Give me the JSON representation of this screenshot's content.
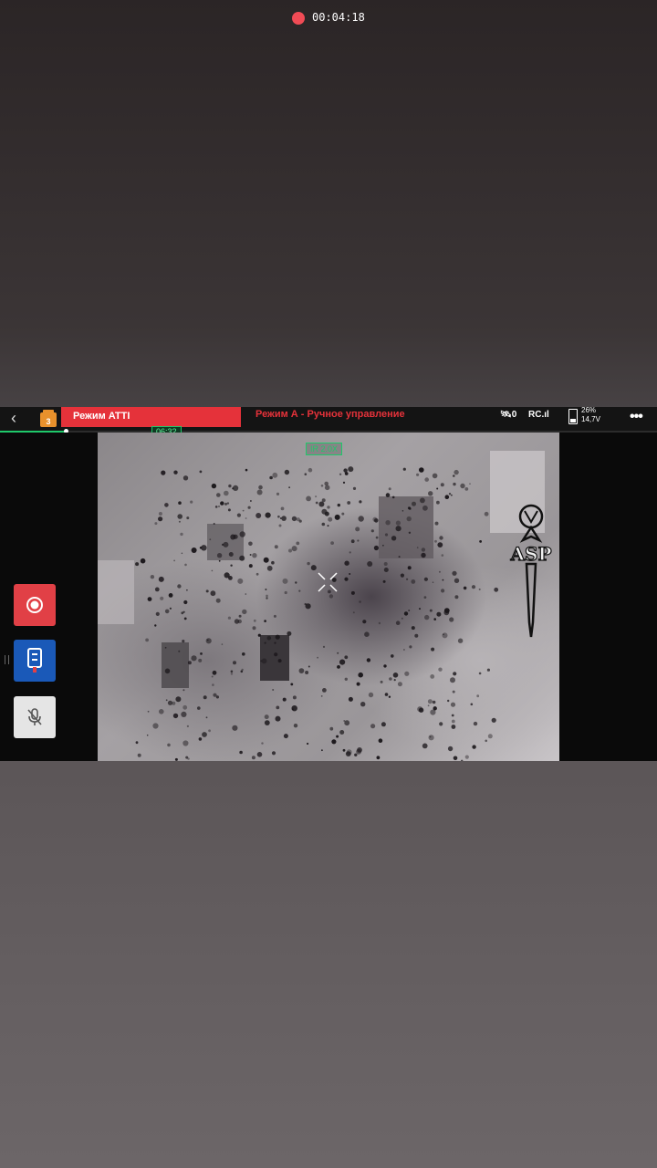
{
  "topbar": {
    "back_icon": "chevron-left-icon",
    "battery_badge_value": "3",
    "atti_label": "Режим ATTI",
    "mode_text": "Режим А - Ручное управление",
    "rec_time": "00:04:18",
    "gps_count": "0",
    "rc_label": "RC",
    "battery_percent": "26%",
    "battery_voltage": "14,7V",
    "more_icon": "ellipsis-icon"
  },
  "playback": {
    "flight_time": "06:32",
    "progress_fraction": 0.1
  },
  "video": {
    "zoom_label": "IR 2.0X",
    "crosshair_icon": "crosshair-icon"
  },
  "side_controls": {
    "record_icon": "record-icon",
    "drone_mode_icon": "tripod-icon",
    "mute_icon": "mic-off-icon"
  },
  "watermark": {
    "text": "ASP"
  },
  "colors": {
    "accent_red": "#e5323a",
    "accent_green": "#1fc86a",
    "record_button": "#e14046",
    "mode_button": "#1a59b8"
  }
}
